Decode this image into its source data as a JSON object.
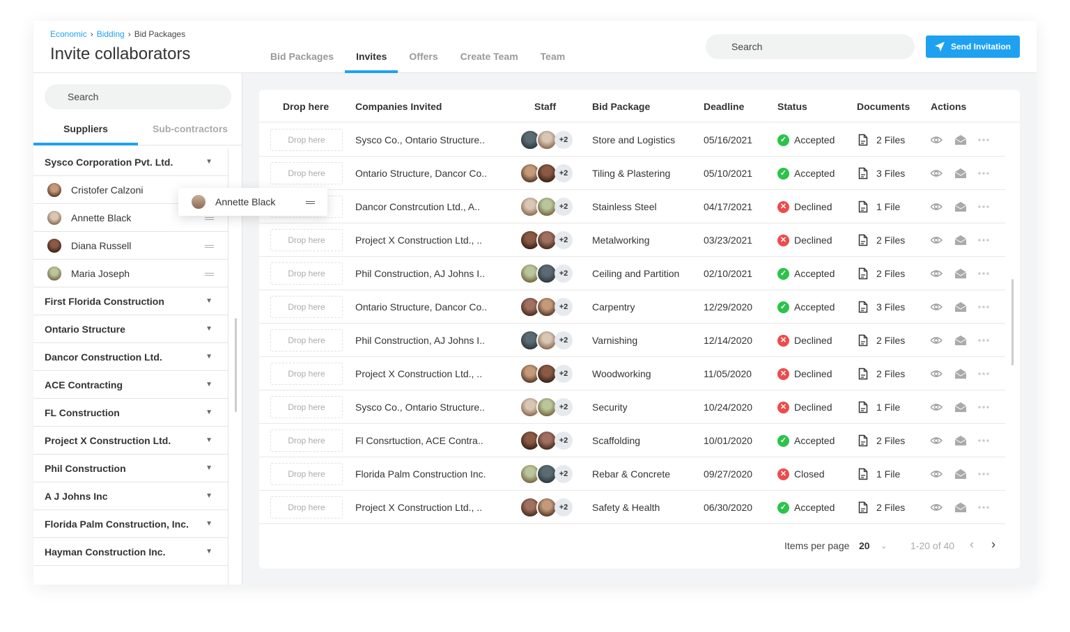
{
  "breadcrumb": {
    "items": [
      "Economic",
      "Bidding",
      "Bid Packages"
    ]
  },
  "page_title": "Invite collaborators",
  "tabs": [
    "Bid Packages",
    "Invites",
    "Offers",
    "Create Team",
    "Team"
  ],
  "active_tab": 1,
  "header_search": {
    "placeholder": "Search"
  },
  "send_button": "Send Invitation",
  "accent": "#1ea1f1",
  "sidebar": {
    "search_placeholder": "Search",
    "tabs": [
      "Suppliers",
      "Sub-contractors"
    ],
    "groups": [
      {
        "name": "Sysco Corporation Pvt. Ltd.",
        "members": [
          "Cristofer Calzoni",
          "Annette Black",
          "Diana Russell",
          "Maria Joseph"
        ]
      },
      {
        "name": "First Florida Construction"
      },
      {
        "name": "Ontario Structure"
      },
      {
        "name": "Dancor Construction Ltd."
      },
      {
        "name": "ACE Contracting"
      },
      {
        "name": "FL Construction"
      },
      {
        "name": "Project X Construction Ltd."
      },
      {
        "name": "Phil Construction"
      },
      {
        "name": "A J Johns Inc"
      },
      {
        "name": "Florida Palm Construction, Inc."
      },
      {
        "name": "Hayman Construction Inc."
      }
    ],
    "dragging": "Annette Black"
  },
  "table": {
    "columns": [
      "Drop here",
      "Companies Invited",
      "Staff",
      "Bid Package",
      "Deadline",
      "Status",
      "Documents",
      "Actions"
    ],
    "drop_label": "Drop here",
    "staff_more": "+2",
    "rows": [
      {
        "companies": "Sysco Co., Ontario Structure..",
        "bid": "Store and Logistics",
        "deadline": "05/16/2021",
        "status": "Accepted",
        "docs": "2 Files"
      },
      {
        "companies": "Ontario Structure, Dancor Co..",
        "bid": "Tiling & Plastering",
        "deadline": "05/10/2021",
        "status": "Accepted",
        "docs": "3 Files"
      },
      {
        "companies": "Dancor Constrcution Ltd., A..",
        "bid": "Stainless Steel",
        "deadline": "04/17/2021",
        "status": "Declined",
        "docs": "1 File"
      },
      {
        "companies": "Project X Construction Ltd., ..",
        "bid": "Metalworking",
        "deadline": "03/23/2021",
        "status": "Declined",
        "docs": "2 Files"
      },
      {
        "companies": "Phil Construction, AJ Johns I..",
        "bid": "Ceiling and Partition",
        "deadline": "02/10/2021",
        "status": "Accepted",
        "docs": "2 Files"
      },
      {
        "companies": "Ontario Structure, Dancor Co..",
        "bid": "Carpentry",
        "deadline": "12/29/2020",
        "status": "Accepted",
        "docs": "3 Files"
      },
      {
        "companies": "Phil Construction, AJ Johns I..",
        "bid": "Varnishing",
        "deadline": "12/14/2020",
        "status": "Declined",
        "docs": "2 Files"
      },
      {
        "companies": "Project X Construction Ltd., ..",
        "bid": "Woodworking",
        "deadline": "11/05/2020",
        "status": "Declined",
        "docs": "2 Files"
      },
      {
        "companies": "Sysco Co., Ontario Structure..",
        "bid": "Security",
        "deadline": "10/24/2020",
        "status": "Declined",
        "docs": "1 File"
      },
      {
        "companies": "Fl Consrtuction, ACE Contra..",
        "bid": "Scaffolding",
        "deadline": "10/01/2020",
        "status": "Accepted",
        "docs": "2 Files"
      },
      {
        "companies": "Florida Palm Construction Inc.",
        "bid": "Rebar & Concrete",
        "deadline": "09/27/2020",
        "status": "Closed",
        "docs": "1 File"
      },
      {
        "companies": "Project X Construction Ltd., ..",
        "bid": "Safety & Health",
        "deadline": "06/30/2020",
        "status": "Accepted",
        "docs": "2 Files"
      }
    ],
    "status_colors": {
      "Accepted": "#2cc34a",
      "Declined": "#ee4b4b",
      "Closed": "#ee4b4b"
    }
  },
  "pagination": {
    "label": "Items per page",
    "per_page": "20",
    "range": "1-20 of 40"
  }
}
